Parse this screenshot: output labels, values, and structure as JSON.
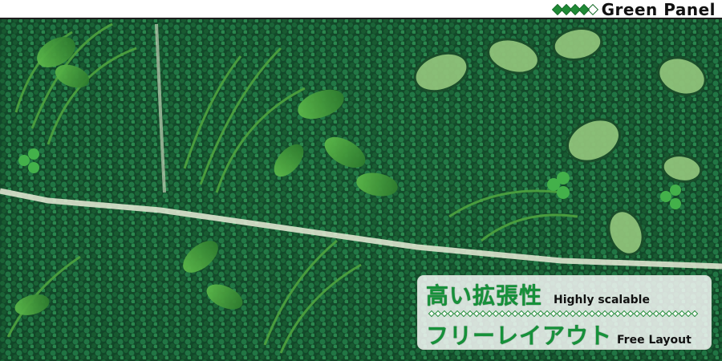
{
  "header": {
    "brand_title": "Green Panel",
    "brand_icon": "diamond-row-icon",
    "diamonds": 5
  },
  "caption": {
    "line1_jp": "高い拡張性",
    "line1_en": "Highly scalable",
    "line2_jp": "フリーレイアウト",
    "line2_en": "Free Layout"
  },
  "photo": {
    "subject": "artificial green wall panels"
  },
  "colors": {
    "accent_green": "#16913a",
    "bar_border": "#1e1e1e"
  }
}
